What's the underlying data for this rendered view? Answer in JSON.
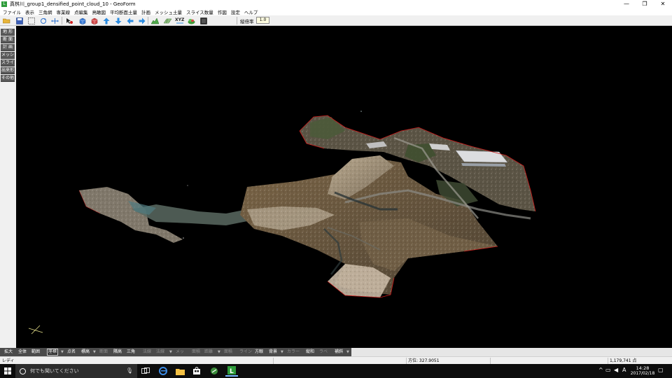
{
  "window": {
    "title": "真桝川_group1_densified_point_cloud_10 - GeoForm",
    "app_icon": "L",
    "controls": [
      "—",
      "❐",
      "✕"
    ]
  },
  "menubar": {
    "items": [
      "ファイル",
      "表示",
      "三角網",
      "専業線",
      "点編集",
      "鳥瞰図",
      "平均断面土量",
      "計画",
      "メッシュ土量",
      "スライス数量",
      "作図",
      "設定",
      "ヘルプ"
    ]
  },
  "toolbar": {
    "zoom_label": "縦倍率",
    "zoom_value": "1.0",
    "icons": [
      "open-folder-icon",
      "save-icon",
      "select-icon",
      "rotate-icon",
      "fit-icon",
      "cursor-point-icon",
      "cube-blue-icon",
      "cube-red-icon",
      "arrow-up-icon",
      "arrow-down-icon",
      "arrow-left-icon",
      "arrow-right-icon",
      "terrain-icon",
      "grid-3d-icon",
      "xyz-icon",
      "cloud-green-icon",
      "display-icon"
    ]
  },
  "left_panel": {
    "items": [
      "地 形",
      "断 面",
      "計 画",
      "メッシュ",
      "スライス",
      "出来形",
      "その他"
    ]
  },
  "bottom_tools": [
    {
      "label": "拡大",
      "state": "normal"
    },
    {
      "label": "全体",
      "state": "normal"
    },
    {
      "label": "範囲",
      "state": "normal"
    },
    {
      "label": "座標",
      "state": "selected"
    },
    {
      "label": "点名",
      "state": "normal"
    },
    {
      "label": "標高",
      "state": "normal"
    },
    {
      "label": "断面",
      "state": "dim"
    },
    {
      "label": "隣高",
      "state": "normal"
    },
    {
      "label": "三角",
      "state": "normal"
    },
    {
      "label": "法線",
      "state": "dim"
    },
    {
      "label": "法線",
      "state": "dim"
    },
    {
      "label": "メッ",
      "state": "dim"
    },
    {
      "label": "面積",
      "state": "dim"
    },
    {
      "label": "距離",
      "state": "dim"
    },
    {
      "label": "面積",
      "state": "dim"
    },
    {
      "label": "ライン",
      "state": "dim"
    },
    {
      "label": "方眼",
      "state": "normal"
    },
    {
      "label": "背景",
      "state": "normal"
    },
    {
      "label": "カラー",
      "state": "dim"
    },
    {
      "label": "縦和",
      "state": "normal"
    },
    {
      "label": "ラベ",
      "state": "dim"
    },
    {
      "label": "補斜",
      "state": "normal"
    }
  ],
  "statusbar": {
    "ready": "レディ",
    "direction": "方位: 327.9051",
    "points": "1,179,741 点"
  },
  "taskbar": {
    "search_placeholder": "何でも聞いてください",
    "time": "14:28",
    "date": "2017/02/18",
    "ime": "A"
  },
  "viewport": {
    "background": "#000000",
    "boundary_color": "#cc1a1a"
  }
}
